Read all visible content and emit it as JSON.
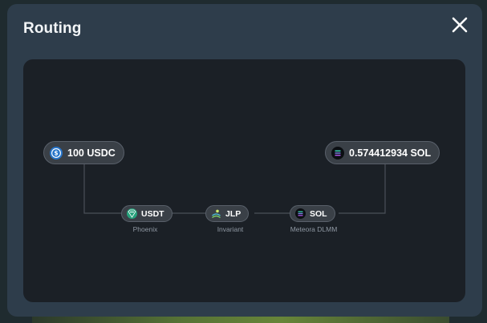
{
  "modal": {
    "title": "Routing",
    "close_icon": "close-icon"
  },
  "route": {
    "input": {
      "amount_label": "100 USDC",
      "icon": "usdc-icon",
      "color": "#2775ca"
    },
    "output": {
      "amount_label": "0.574412934 SOL",
      "icon": "sol-icon",
      "color": "#0b0e12"
    },
    "hops": [
      {
        "token": "USDT",
        "dex": "Phoenix",
        "icon": "usdt-icon",
        "color": "#26a17b"
      },
      {
        "token": "JLP",
        "dex": "Invariant",
        "icon": "jlp-icon",
        "color": "#3a4047"
      },
      {
        "token": "SOL",
        "dex": "Meteora DLMM",
        "icon": "sol-icon",
        "color": "#0b0e12"
      }
    ]
  },
  "colors": {
    "modal_bg": "#2e3d4b",
    "panel_bg": "#1b2026",
    "node_bg": "#3a4047",
    "link": "#4a5058"
  }
}
